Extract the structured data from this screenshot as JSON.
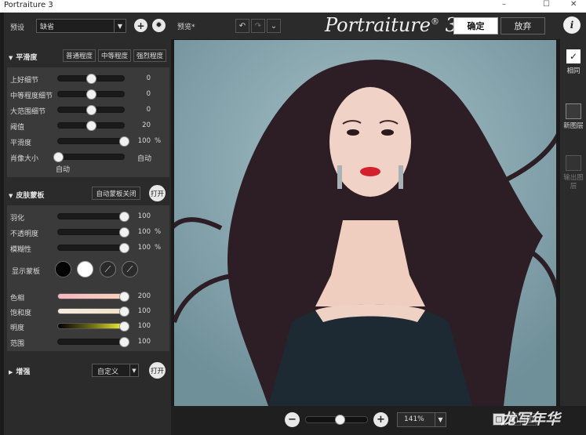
{
  "window": {
    "title": "Portraiture 3",
    "min_glyph": "–",
    "max_glyph": "☐",
    "close_glyph": "✕"
  },
  "preset": {
    "label": "预设",
    "value": "缺省"
  },
  "toolbar": {
    "preview_label": "预览*",
    "logo_text": "Portraiture",
    "logo_suffix": "3",
    "ok_label": "确定",
    "cancel_label": "放弃",
    "info_label": "i"
  },
  "smoothing": {
    "title": "平滑度",
    "buttons": [
      "普通程度",
      "中等程度",
      "强烈程度"
    ],
    "sliders": [
      {
        "label": "上好细节",
        "value": "0",
        "unit": "",
        "fraction": 0.5
      },
      {
        "label": "中等程度细节",
        "value": "0",
        "unit": "",
        "fraction": 0.5
      },
      {
        "label": "大范围细节",
        "value": "0",
        "unit": "",
        "fraction": 0.5
      },
      {
        "label": "阈值",
        "value": "20",
        "unit": "",
        "fraction": 0.5
      },
      {
        "label": "平滑度",
        "value": "100",
        "unit": "%",
        "fraction": 1.0
      }
    ],
    "pixel_size": {
      "label": "肖像大小",
      "value": "自动",
      "thumb_label": "自动",
      "fraction": 0.0
    }
  },
  "skin_mask": {
    "title": "皮肤蒙板",
    "auto_button": "自动蒙板关闭",
    "open_button": "打开",
    "sliders": [
      {
        "label": "羽化",
        "value": "100",
        "unit": "",
        "fraction": 1.0
      },
      {
        "label": "不透明度",
        "value": "100",
        "unit": "%",
        "fraction": 1.0
      },
      {
        "label": "模糊性",
        "value": "100",
        "unit": "%",
        "fraction": 1.0
      }
    ],
    "show_mask_label": "显示蒙板",
    "color_sliders": [
      {
        "label": "色相",
        "value": "200",
        "fraction": 1.0,
        "gradient": "linear-gradient(90deg,#f7b5c4,#f8d2b8)"
      },
      {
        "label": "饱和度",
        "value": "100",
        "fraction": 1.0,
        "gradient": "linear-gradient(90deg,#f4ece0,#f1e3c8)"
      },
      {
        "label": "明度",
        "value": "100",
        "fraction": 1.0,
        "gradient": "linear-gradient(90deg,#000000,#6b6a10,#f7f233)"
      },
      {
        "label": "范围",
        "value": "100",
        "fraction": 1.0,
        "gradient": ""
      }
    ]
  },
  "enhance": {
    "title": "增强",
    "preset": "自定义",
    "open_button": "打开"
  },
  "right_panel": {
    "same_label": "相同",
    "new_layer_label": "新图层",
    "output_label": "输出图层"
  },
  "zoom": {
    "value": "141%",
    "minus": "−",
    "plus": "+",
    "fraction": 0.55
  },
  "watermark": "龙写年华"
}
